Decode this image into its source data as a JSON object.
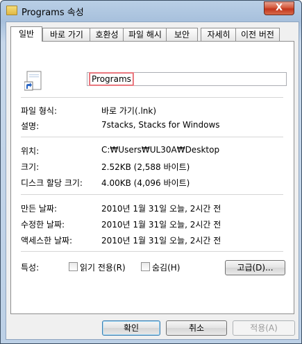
{
  "window": {
    "title": "Programs 속성",
    "close_symbol": "X"
  },
  "tabs": [
    {
      "label": "일반",
      "active": true
    },
    {
      "label": "바로 가기"
    },
    {
      "label": "호환성"
    },
    {
      "label": "파일 해시"
    },
    {
      "label": "보안"
    },
    {
      "label": "자세히"
    },
    {
      "label": "이전 버전"
    }
  ],
  "general": {
    "name": "Programs",
    "file_type_label": "파일 형식:",
    "file_type_value": "바로 가기(.lnk)",
    "description_label": "설명:",
    "description_value": "7stacks, Stacks for Windows",
    "location_label": "위치:",
    "location_value": "C:₩Users₩UL30A₩Desktop",
    "size_label": "크기:",
    "size_value": "2.52KB (2,588 바이트)",
    "size_on_disk_label": "디스크 할당 크기:",
    "size_on_disk_value": "4.00KB (4,096 바이트)",
    "created_label": "만든 날짜:",
    "created_value": "2010년 1월 31일 오늘, 2시간 전",
    "modified_label": "수정한 날짜:",
    "modified_value": "2010년 1월 31일 오늘, 2시간 전",
    "accessed_label": "액세스한 날짜:",
    "accessed_value": "2010년 1월 31일 오늘, 2시간 전",
    "attributes_label": "특성:",
    "readonly_label": "읽기 전용(R)",
    "readonly_checked": false,
    "hidden_label": "숨김(H)",
    "hidden_checked": false,
    "advanced_button": "고급(D)..."
  },
  "footer": {
    "ok": "확인",
    "cancel": "취소",
    "apply": "적용(A)"
  }
}
